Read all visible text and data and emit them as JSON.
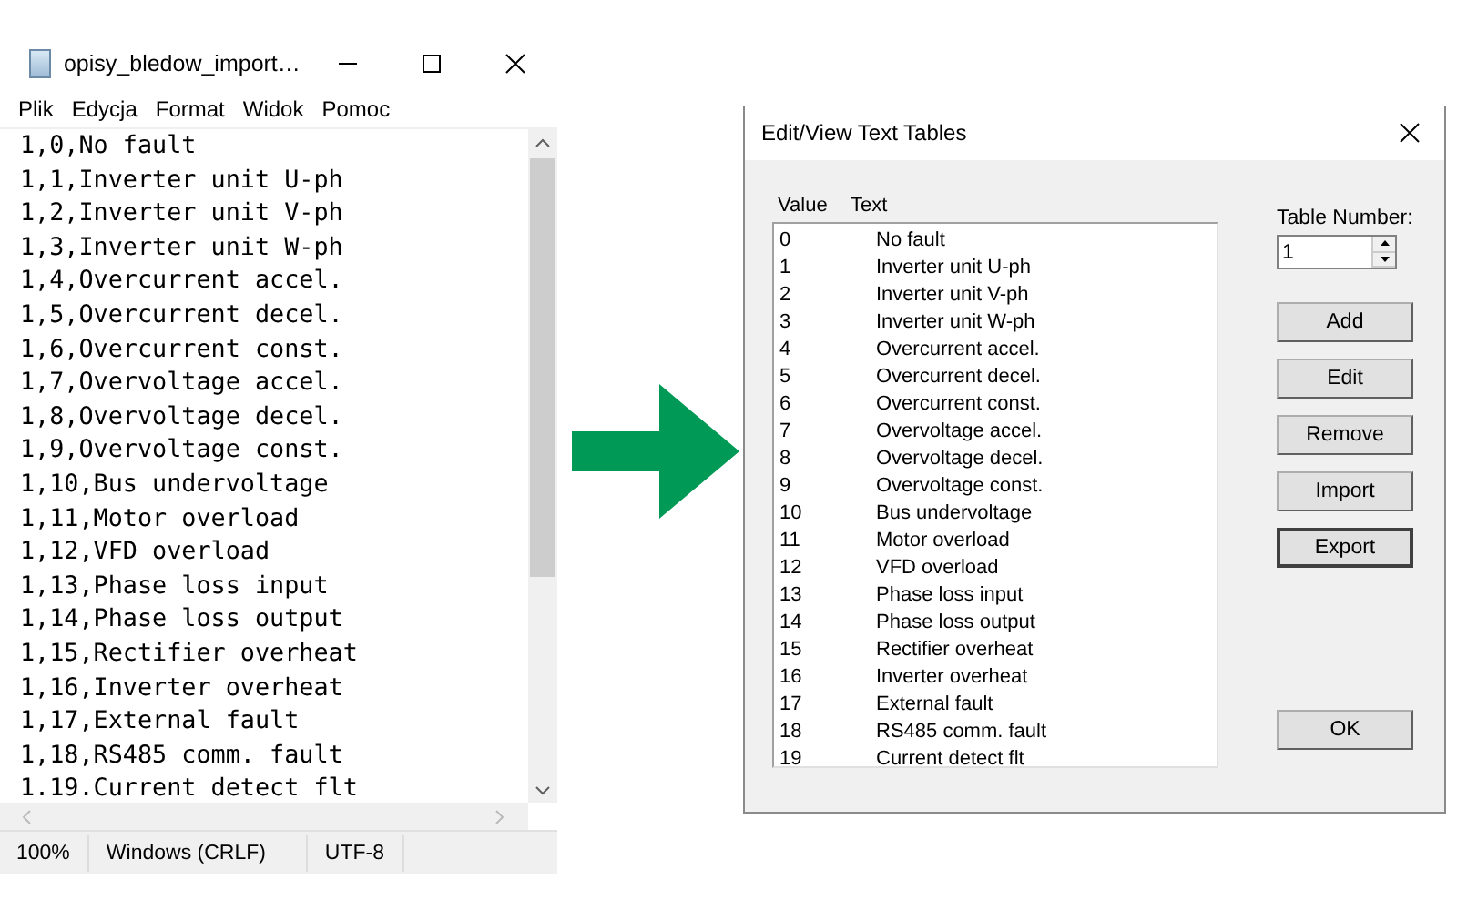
{
  "notepad": {
    "title": "opisy_bledow_import…",
    "menu": [
      "Plik",
      "Edycja",
      "Format",
      "Widok",
      "Pomoc"
    ],
    "lines": [
      "1,0,No fault",
      "1,1,Inverter unit U-ph",
      "1,2,Inverter unit V-ph",
      "1,3,Inverter unit W-ph",
      "1,4,Overcurrent accel.",
      "1,5,Overcurrent decel.",
      "1,6,Overcurrent const.",
      "1,7,Overvoltage accel.",
      "1,8,Overvoltage decel.",
      "1,9,Overvoltage const.",
      "1,10,Bus undervoltage",
      "1,11,Motor overload",
      "1,12,VFD overload",
      "1,13,Phase loss input",
      "1,14,Phase loss output",
      "1,15,Rectifier overheat",
      "1,16,Inverter overheat",
      "1,17,External fault",
      "1,18,RS485 comm. fault",
      "1.19.Current detect flt"
    ],
    "status_bar": [
      "100%",
      "Windows (CRLF)",
      "UTF-8"
    ]
  },
  "dialog": {
    "title": "Edit/View Text Tables",
    "columns": [
      "Value",
      "Text"
    ],
    "rows": [
      {
        "value": "0",
        "text": "No fault"
      },
      {
        "value": "1",
        "text": "Inverter unit U-ph"
      },
      {
        "value": "2",
        "text": "Inverter unit V-ph"
      },
      {
        "value": "3",
        "text": "Inverter unit W-ph"
      },
      {
        "value": "4",
        "text": "Overcurrent accel."
      },
      {
        "value": "5",
        "text": "Overcurrent decel."
      },
      {
        "value": "6",
        "text": "Overcurrent const."
      },
      {
        "value": "7",
        "text": "Overvoltage accel."
      },
      {
        "value": "8",
        "text": "Overvoltage decel."
      },
      {
        "value": "9",
        "text": "Overvoltage const."
      },
      {
        "value": "10",
        "text": "Bus undervoltage"
      },
      {
        "value": "11",
        "text": "Motor overload"
      },
      {
        "value": "12",
        "text": "VFD overload"
      },
      {
        "value": "13",
        "text": "Phase loss input"
      },
      {
        "value": "14",
        "text": "Phase loss output"
      },
      {
        "value": "15",
        "text": "Rectifier overheat"
      },
      {
        "value": "16",
        "text": "Inverter overheat"
      },
      {
        "value": "17",
        "text": "External fault"
      },
      {
        "value": "18",
        "text": "RS485 comm. fault"
      },
      {
        "value": "19",
        "text": "Current detect flt"
      }
    ],
    "table_number_label": "Table Number:",
    "table_number": "1",
    "buttons": [
      {
        "label": "Add",
        "focused": false
      },
      {
        "label": "Edit",
        "focused": false
      },
      {
        "label": "Remove",
        "focused": false
      },
      {
        "label": "Import",
        "focused": false
      },
      {
        "label": "Export",
        "focused": true
      }
    ],
    "ok_button": "OK"
  }
}
